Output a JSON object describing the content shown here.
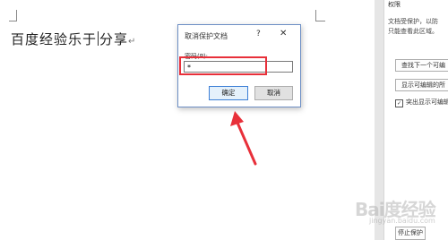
{
  "document": {
    "text": "百度经验乐于分享",
    "text_before_caret": "百度经验乐于",
    "text_after_caret": "分享",
    "paragraph_mark": "↵"
  },
  "dialog": {
    "title": "取消保护文档",
    "help_glyph": "?",
    "close_glyph": "✕",
    "password_label": "密码(P):",
    "password_value": "*",
    "ok_label": "确定",
    "cancel_label": "取消"
  },
  "annotations": {
    "highlight_color": "#e8303a",
    "arrow_color": "#e8303a"
  },
  "side_pane": {
    "heading": "权限",
    "desc_line1": "文档受保护，以防",
    "desc_line2": "只能查看此区域。",
    "find_next_button": "查找下一个可编",
    "show_all_button": "显示可编辑的所",
    "highlight_checkbox": {
      "label": "突出显示可编辑",
      "checked": true,
      "check_glyph": "✓"
    },
    "stop_protection_button": "停止保护"
  },
  "watermark": {
    "brand": "Bai度经验",
    "sub": "jingyan.baidu.com"
  }
}
